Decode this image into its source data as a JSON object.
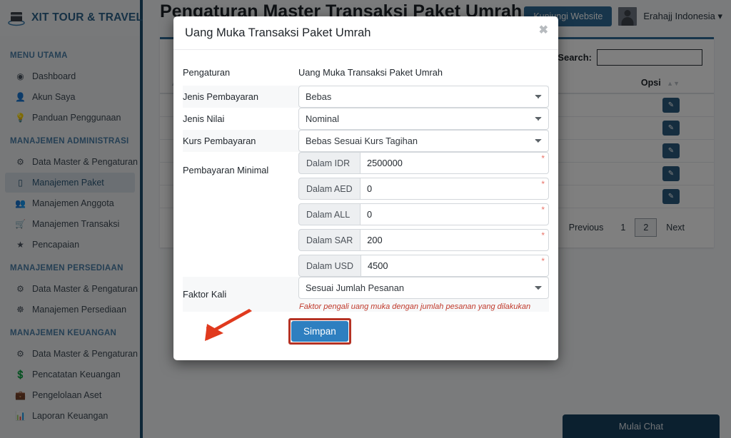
{
  "sidebar": {
    "brand": "XIT TOUR & TRAVEL",
    "brand_logo_icon": "kaaba-icon",
    "groups": [
      {
        "header": "MENU UTAMA",
        "items": [
          {
            "label": "Dashboard",
            "icon": "globe-icon",
            "active": false
          },
          {
            "label": "Akun Saya",
            "icon": "user-icon",
            "active": false
          },
          {
            "label": "Panduan Penggunaan",
            "icon": "lightbulb-icon",
            "active": false
          }
        ]
      },
      {
        "header": "MANAJEMEN ADMINISTRASI",
        "items": [
          {
            "label": "Data Master & Pengaturan",
            "icon": "gears-icon",
            "active": false
          },
          {
            "label": "Manajemen Paket",
            "icon": "package-icon",
            "active": true
          },
          {
            "label": "Manajemen Anggota",
            "icon": "users-icon",
            "active": false
          },
          {
            "label": "Manajemen Transaksi",
            "icon": "cart-icon",
            "active": false
          },
          {
            "label": "Pencapaian",
            "icon": "trophy-icon",
            "active": false
          }
        ]
      },
      {
        "header": "MANAJEMEN PERSEDIAAN",
        "items": [
          {
            "label": "Data Master & Pengaturan",
            "icon": "gears-icon",
            "active": false
          },
          {
            "label": "Manajemen Persediaan",
            "icon": "boxes-icon",
            "active": false
          }
        ]
      },
      {
        "header": "MANAJEMEN KEUANGAN",
        "items": [
          {
            "label": "Data Master & Pengaturan",
            "icon": "gears-icon",
            "active": false
          },
          {
            "label": "Pencatatan Keuangan",
            "icon": "money-icon",
            "active": false
          },
          {
            "label": "Pengelolaan Aset",
            "icon": "briefcase-icon",
            "active": false
          },
          {
            "label": "Laporan Keuangan",
            "icon": "report-icon",
            "active": false
          }
        ]
      }
    ]
  },
  "topbar": {
    "website_button": "Kunjungi Website",
    "user_name": "Erahajj Indonesia",
    "caret_icon": "caret-down-icon",
    "avatar_icon": "avatar-icon"
  },
  "page": {
    "title": "Pengaturan Master Transaksi Paket Umrah"
  },
  "table_panel": {
    "search_label": "Search:",
    "search_value": "",
    "columns": [
      "",
      "Opsi"
    ],
    "row_count": 5,
    "edit_icon": "pencil-icon",
    "sort_icon": "sort-icon",
    "pagination": {
      "previous": "Previous",
      "pages": [
        "1",
        "2"
      ],
      "current": "2",
      "next": "Next"
    }
  },
  "chat": {
    "label": "Mulai Chat"
  },
  "modal": {
    "title": "Uang Muka Transaksi Paket Umrah",
    "close_icon": "close-icon",
    "rows": [
      {
        "label": "Pengaturan",
        "type": "static",
        "value": "Uang Muka Transaksi Paket Umrah"
      },
      {
        "label": "Jenis Pembayaran",
        "type": "select",
        "value": "Bebas"
      },
      {
        "label": "Jenis Nilai",
        "type": "select",
        "value": "Nominal"
      },
      {
        "label": "Kurs Pembayaran",
        "type": "select",
        "value": "Bebas Sesuai Kurs Tagihan"
      }
    ],
    "minimal_payment": {
      "label": "Pembayaran Minimal",
      "fields": [
        {
          "addon": "Dalam IDR",
          "value": "2500000",
          "required": "*"
        },
        {
          "addon": "Dalam AED",
          "value": "0",
          "required": "*"
        },
        {
          "addon": "Dalam ALL",
          "value": "0",
          "required": "*"
        },
        {
          "addon": "Dalam SAR",
          "value": "200",
          "required": "*"
        },
        {
          "addon": "Dalam USD",
          "value": "4500",
          "required": "*"
        }
      ]
    },
    "faktor_kali": {
      "label": "Faktor Kali",
      "value": "Sesuai Jumlah Pesanan",
      "help": "Faktor pengali uang muka dengan jumlah pesanan yang dilakukan"
    },
    "save_button": "Simpan"
  },
  "annotation": {
    "arrow_color": "#e03a1e",
    "highlight_color": "#b53224"
  }
}
